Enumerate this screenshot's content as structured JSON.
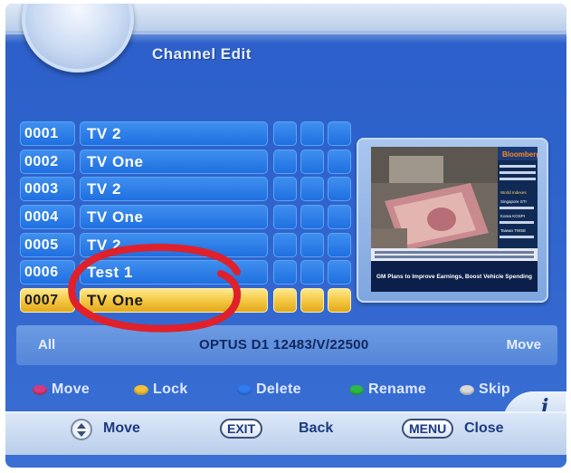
{
  "header": {
    "title": "Channel Edit"
  },
  "channels": [
    {
      "number": "0001",
      "name": "TV 2"
    },
    {
      "number": "0002",
      "name": "TV One"
    },
    {
      "number": "0003",
      "name": "TV 2"
    },
    {
      "number": "0004",
      "name": "TV One"
    },
    {
      "number": "0005",
      "name": "TV 2"
    },
    {
      "number": "0006",
      "name": "Test 1"
    },
    {
      "number": "0007",
      "name": "TV One"
    }
  ],
  "selected_channel_number": "0007",
  "preview": {
    "brand": "Bloomberg",
    "ticker": "GM Plans to Improve Earnings, Boost Vehicle Spending",
    "market_header": "World Indexes",
    "market_rows": [
      "Singapore STI",
      "Korea KOSPI",
      "Taiwan TWSE"
    ]
  },
  "info_bar": {
    "group": "All",
    "satellite": "OPTUS D1 12483/V/22500",
    "action": "Move"
  },
  "function_keys": [
    {
      "label": "Move",
      "color": "#d8397a"
    },
    {
      "label": "Lock",
      "color": "#f2c23a"
    },
    {
      "label": "Delete",
      "color": "#2e7cf0"
    },
    {
      "label": "Rename",
      "color": "#2db84a"
    },
    {
      "label": "Skip",
      "color": "#d9d9d9"
    }
  ],
  "bottom_bar": {
    "move_label": "Move",
    "exit_key": "EXIT",
    "back_label": "Back",
    "menu_key": "MENU",
    "close_label": "Close",
    "info_icon": "i"
  },
  "colors": {
    "background": "#2f63cc",
    "row_blue": "#2b7ce8",
    "row_selected": "#f2c23a",
    "annotation": "#e0202a"
  }
}
